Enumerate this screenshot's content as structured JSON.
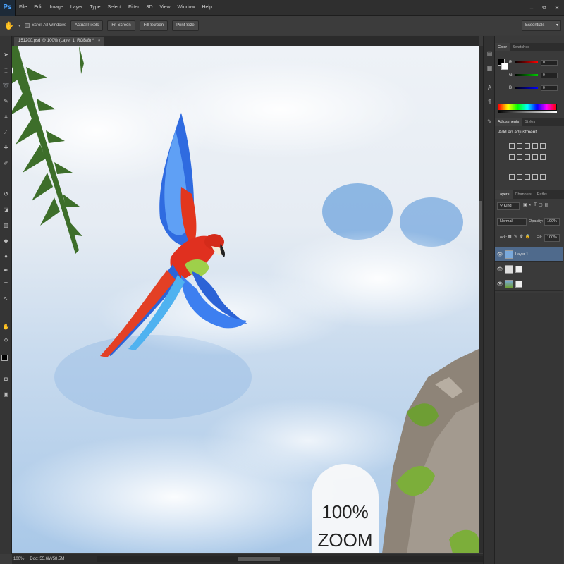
{
  "app": {
    "logo": "Ps"
  },
  "menu": {
    "items": [
      "File",
      "Edit",
      "Image",
      "Layer",
      "Type",
      "Select",
      "Filter",
      "3D",
      "View",
      "Window",
      "Help"
    ]
  },
  "window_controls": {
    "minimize": "–",
    "restore": "⧉",
    "close": "✕"
  },
  "options_bar": {
    "tool_icon": "hand-tool-icon",
    "scroll_all_windows": "Scroll All Windows",
    "buttons": [
      "Actual Pixels",
      "Fit Screen",
      "Fill Screen",
      "Print Size"
    ],
    "workspace": "Essentials"
  },
  "document": {
    "tab_label": "151200.psd @ 100% (Layer 1, RGB/8) *",
    "zoom_badge": {
      "line1": "100%",
      "line2": "ZOOM"
    }
  },
  "status_bar": {
    "zoom": "100%",
    "doc_info": "Doc: 55.6M/58.5M"
  },
  "color_panel": {
    "tabs": [
      "Color",
      "Swatches"
    ],
    "channels": [
      {
        "label": "R",
        "value": "0",
        "color": "#e02020"
      },
      {
        "label": "G",
        "value": "0",
        "color": "#20c020"
      },
      {
        "label": "B",
        "value": "0",
        "color": "#2030e0"
      }
    ]
  },
  "adjustments_panel": {
    "tabs": [
      "Adjustments",
      "Styles"
    ],
    "title": "Add an adjustment"
  },
  "layers_panel": {
    "tabs": [
      "Layers",
      "Channels",
      "Paths"
    ],
    "filter_kind": "Kind",
    "blend_mode": "Normal",
    "opacity_label": "Opacity:",
    "opacity_value": "100%",
    "lock_label": "Lock:",
    "fill_label": "Fill:",
    "fill_value": "100%",
    "layers": [
      {
        "name": "Layer 1",
        "selected": true
      },
      {
        "name": "",
        "selected": false
      },
      {
        "name": "",
        "selected": false
      }
    ]
  },
  "colors": {
    "accent_selection": "#4f6a8c",
    "panel_bg": "#3a3a3a",
    "menu_bg": "#2f2f2f",
    "sky": "#aac8e6"
  }
}
